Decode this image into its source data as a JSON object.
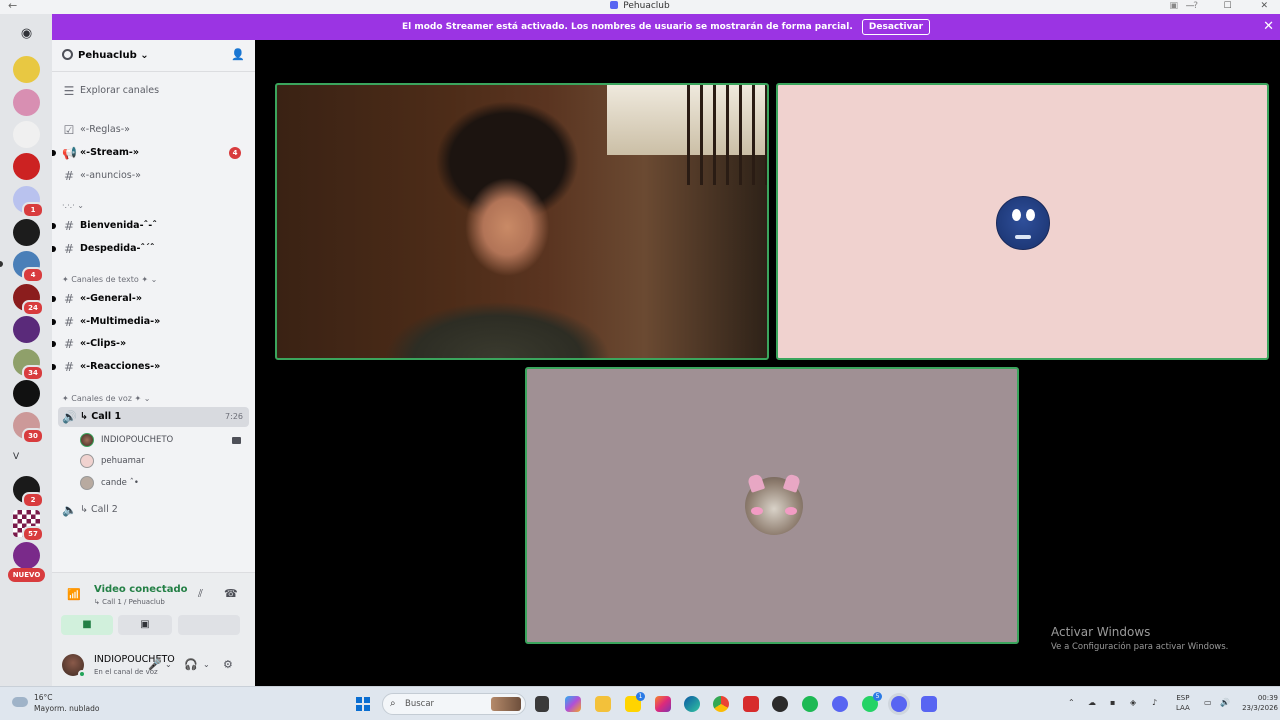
{
  "window": {
    "title": "Pehuaclub",
    "back": "←",
    "forward": "→",
    "minimize": "—",
    "maximize": "☐",
    "close": "✕"
  },
  "banner": {
    "text": "El modo Streamer está activado. Los nombres de usuario se mostrarán de forma parcial.",
    "button": "Desactivar",
    "close": "✕"
  },
  "rail": {
    "badges": [
      "1",
      "4",
      "24",
      "34",
      "30",
      "2",
      "57"
    ],
    "nuevo": "NUEVO",
    "v_label": "V"
  },
  "server": {
    "name": "Pehuaclub ⌄",
    "explore": "Explorar canales"
  },
  "channels": [
    {
      "name": "«-Reglas-»"
    },
    {
      "name": "«-Stream-»",
      "mentions": "4"
    },
    {
      "name": "«-anuncios-»"
    },
    {
      "name": "Bienvenida-ˆ-ˆ"
    },
    {
      "name": "Despedida-ˆ´ˆ"
    },
    {
      "name": "«-General-»"
    },
    {
      "name": "«-Multimedia-»"
    },
    {
      "name": "«-Clips-»"
    },
    {
      "name": "«-Reacciones-»"
    }
  ],
  "categories": {
    "misc": "·.·.· ⌄",
    "text": "✦ Canales de texto ✦ ⌄",
    "voice": "✦ Canales de voz ✦ ⌄"
  },
  "voice": {
    "call1": "↳ Call 1",
    "call1_timer": "7:26",
    "call2": "↳ Call 2",
    "users": [
      "INDIOPOUCHETO",
      "pehuamar",
      "cande ˆ•"
    ]
  },
  "voice_panel": {
    "status": "Video conectado",
    "location": "↳ Call 1 / Pehuaclub"
  },
  "user_panel": {
    "name": "INDIOPOUCHETO",
    "status": "En el canal de voz"
  },
  "watermark": {
    "line1": "Activar Windows",
    "line2": "Ve a Configuración para activar Windows."
  },
  "taskbar": {
    "temp": "16°C",
    "weather": "Mayorm. nublado",
    "search_placeholder": "Buscar",
    "lang1": "ESP",
    "lang2": "LAA",
    "time": "00:39",
    "date": "23/3/2026",
    "badge_a": "1",
    "badge_b": "5"
  },
  "colors": {
    "accent": "#5865f2",
    "banner": "#9b34e3",
    "speaking": "#3ba55d",
    "mention": "#d83c3e"
  }
}
